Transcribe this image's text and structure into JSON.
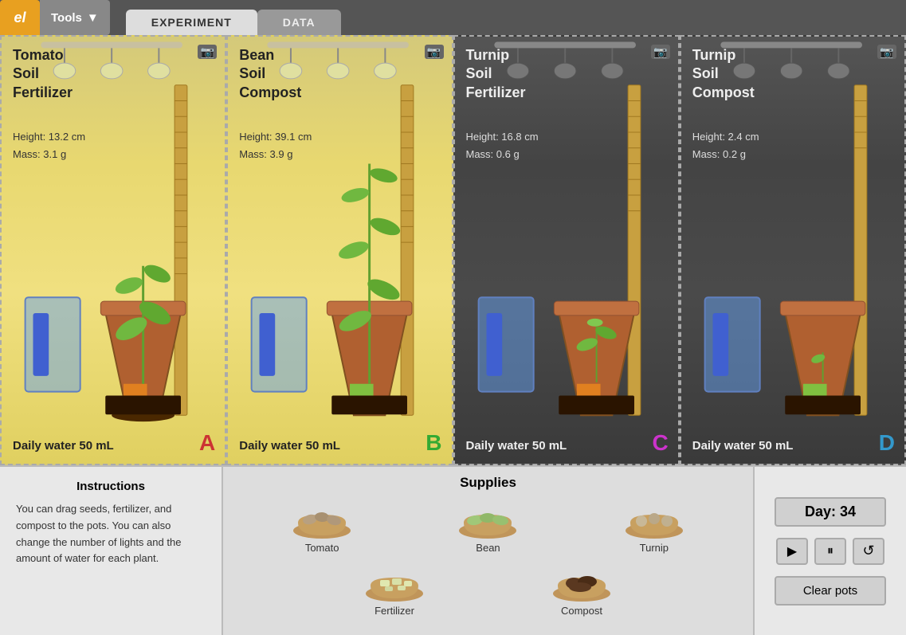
{
  "header": {
    "logo": "el",
    "tools_label": "Tools",
    "tabs": [
      {
        "label": "EXPERIMENT",
        "active": true
      },
      {
        "label": "DATA",
        "active": false
      }
    ]
  },
  "pots": [
    {
      "id": "A",
      "plant": "Tomato",
      "soil": "Soil",
      "additive": "Fertilizer",
      "height": "Height: 13.2 cm",
      "mass": "Mass: 3.1 g",
      "water": "Daily water 50  mL",
      "letter": "A",
      "letter_color": "#cc3333",
      "theme": "light"
    },
    {
      "id": "B",
      "plant": "Bean",
      "soil": "Soil",
      "additive": "Compost",
      "height": "Height: 39.1 cm",
      "mass": "Mass: 3.9 g",
      "water": "Daily water 50  mL",
      "letter": "B",
      "letter_color": "#33aa33",
      "theme": "light"
    },
    {
      "id": "C",
      "plant": "Turnip",
      "soil": "Soil",
      "additive": "Fertilizer",
      "height": "Height: 16.8 cm",
      "mass": "Mass: 0.6 g",
      "water": "Daily water 50  mL",
      "letter": "C",
      "letter_color": "#cc33cc",
      "theme": "dark"
    },
    {
      "id": "D",
      "plant": "Turnip",
      "soil": "Soil",
      "additive": "Compost",
      "height": "Height: 2.4 cm",
      "mass": "Mass: 0.2 g",
      "water": "Daily water 50  mL",
      "letter": "D",
      "letter_color": "#3399cc",
      "theme": "dark"
    }
  ],
  "instructions": {
    "title": "Instructions",
    "text": "You can drag seeds, fertilizer, and compost to the pots. You can also change the number of lights and the amount of water for each plant."
  },
  "supplies": {
    "title": "Supplies",
    "items_row1": [
      {
        "label": "Tomato",
        "type": "seed_tomato"
      },
      {
        "label": "Bean",
        "type": "seed_bean"
      },
      {
        "label": "Turnip",
        "type": "seed_turnip"
      }
    ],
    "items_row2": [
      {
        "label": "Fertilizer",
        "type": "fertilizer"
      },
      {
        "label": "Compost",
        "type": "compost"
      }
    ]
  },
  "controls": {
    "day_label": "Day: 34",
    "play_icon": "▶",
    "pause_icon": "⏸",
    "reset_icon": "↺",
    "clear_pots_label": "Clear pots"
  }
}
